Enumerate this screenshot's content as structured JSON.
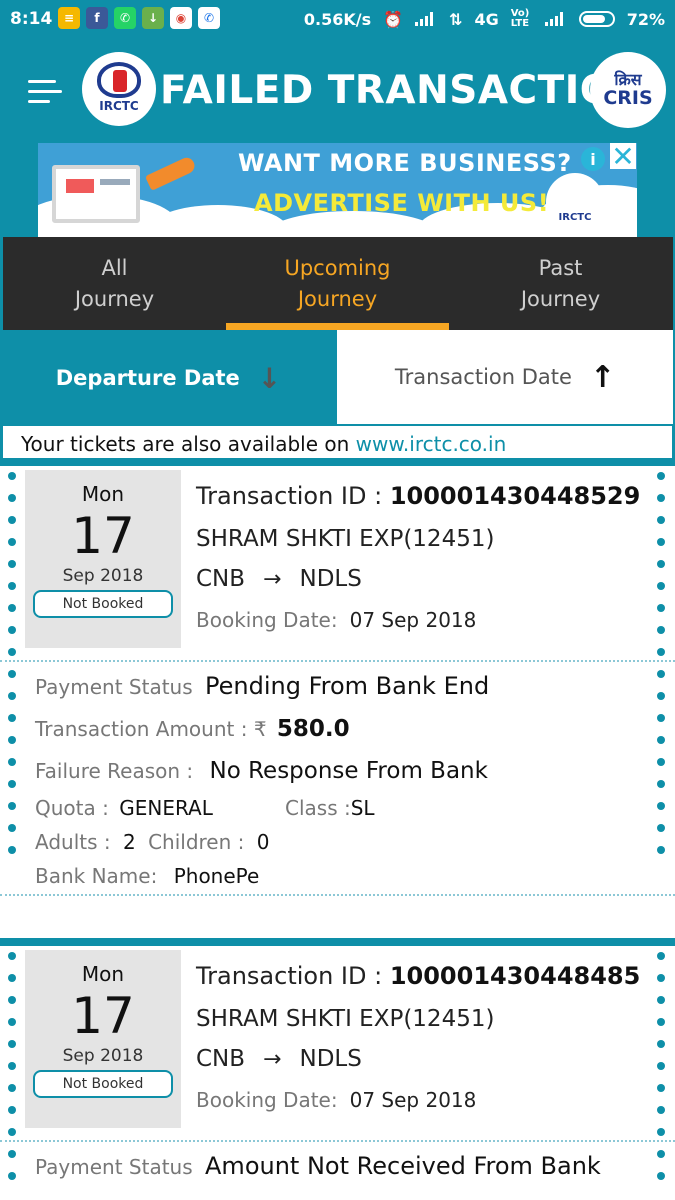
{
  "status_bar": {
    "time": "8:14",
    "speed": "0.56K/s",
    "network": "4G",
    "volte": "Vo) LTE",
    "battery": "72%"
  },
  "header": {
    "title": "FAILED TRANSACTION",
    "left_logo_text": "IRCTC",
    "right_logo_text_hindi": "क्रिस",
    "right_logo_text": "CRIS"
  },
  "ad": {
    "line1": "WANT MORE BUSINESS?",
    "line2": "ADVERTISE WITH US!",
    "mini_logo": "IRCTC",
    "info": "i",
    "close": "✕"
  },
  "tabs": [
    {
      "line1": "All",
      "line2": "Journey",
      "active": false
    },
    {
      "line1": "Upcoming",
      "line2": "Journey",
      "active": true
    },
    {
      "line1": "Past",
      "line2": "Journey",
      "active": false
    }
  ],
  "sort": {
    "departure": "Departure Date",
    "transaction": "Transaction Date"
  },
  "info_line": {
    "text": "Your tickets are also available on ",
    "link": "www.irctc.co.in"
  },
  "cards": [
    {
      "dow": "Mon",
      "day": "17",
      "month_year": "Sep 2018",
      "badge": "Not Booked",
      "txn_label": "Transaction ID : ",
      "txn_id": "100001430448529",
      "train": "SHRAM SHKTI EXP(12451)",
      "from": "CNB",
      "to": "NDLS",
      "booking_label": "Booking Date:",
      "booking_date": "07 Sep 2018",
      "payment_label": "Payment Status",
      "payment_status": "Pending From Bank End",
      "amount_label": "Transaction Amount : ₹",
      "amount": "580.0",
      "failure_label": "Failure Reason :",
      "failure_reason": "No Response From Bank",
      "quota_label": "Quota :",
      "quota": "GENERAL",
      "class_label": "Class :",
      "class": "SL",
      "adults_label": "Adults :",
      "adults": "2",
      "children_label": "Children :",
      "children": "0",
      "bank_label": "Bank Name:",
      "bank": "PhonePe"
    },
    {
      "dow": "Mon",
      "day": "17",
      "month_year": "Sep 2018",
      "badge": "Not Booked",
      "txn_label": "Transaction ID : ",
      "txn_id": "100001430448485",
      "train": "SHRAM SHKTI EXP(12451)",
      "from": "CNB",
      "to": "NDLS",
      "booking_label": "Booking Date:",
      "booking_date": "07 Sep 2018",
      "payment_label": "Payment Status",
      "payment_status": "Amount Not Received From Bank"
    }
  ]
}
